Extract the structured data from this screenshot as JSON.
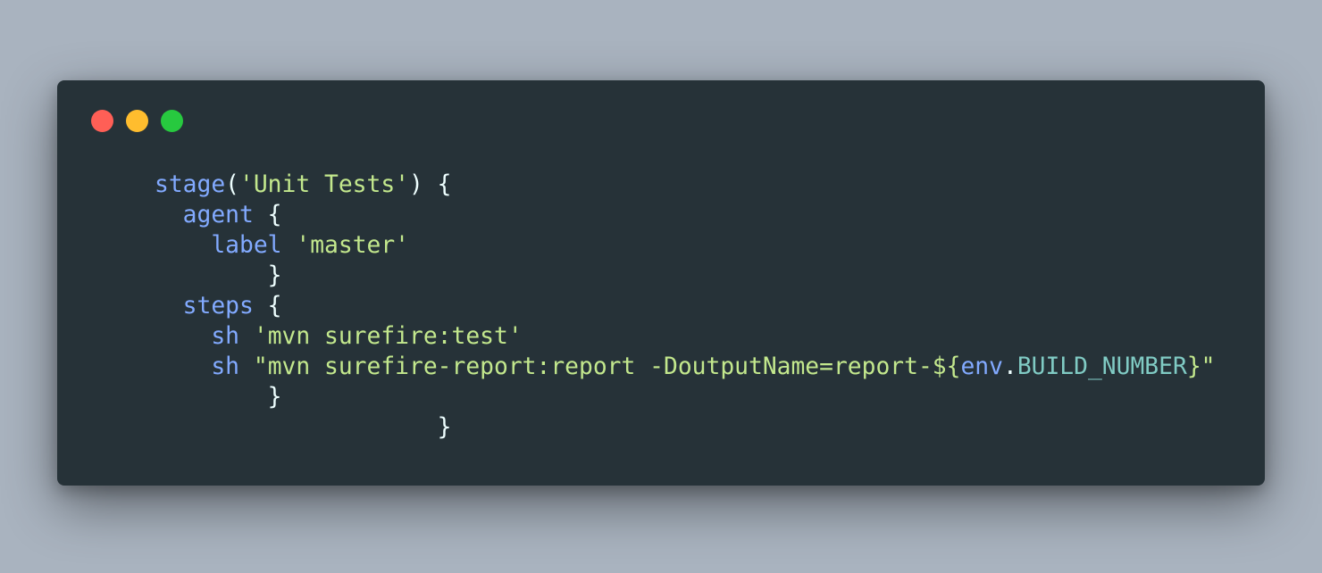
{
  "window": {
    "background": "#263238",
    "controls": [
      {
        "name": "close",
        "color": "#ff5f56"
      },
      {
        "name": "minimize",
        "color": "#ffbd2e"
      },
      {
        "name": "maximize",
        "color": "#27c93f"
      }
    ]
  },
  "theme": {
    "keyword": "#82aaff",
    "string": "#c3e88d",
    "property": "#80cbc4",
    "punctuation": "#eeffff",
    "page_background": "#a9b3bf"
  },
  "code": {
    "lines": [
      [
        {
          "indent": 0,
          "text": "stage",
          "type": "kw"
        },
        {
          "text": "(",
          "type": "punc"
        },
        {
          "text": "'Unit Tests'",
          "type": "str"
        },
        {
          "text": ") {",
          "type": "punc"
        }
      ],
      [
        {
          "indent": 2,
          "text": "agent",
          "type": "kw"
        },
        {
          "text": " {",
          "type": "punc"
        }
      ],
      [
        {
          "indent": 4,
          "text": "label",
          "type": "kw"
        },
        {
          "text": " ",
          "type": "punc"
        },
        {
          "text": "'master'",
          "type": "str"
        }
      ],
      [
        {
          "indent": 8,
          "text": "}",
          "type": "punc"
        }
      ],
      [
        {
          "indent": 2,
          "text": "steps",
          "type": "kw"
        },
        {
          "text": " {",
          "type": "punc"
        }
      ],
      [
        {
          "indent": 4,
          "text": "sh",
          "type": "kw"
        },
        {
          "text": " ",
          "type": "punc"
        },
        {
          "text": "'mvn surefire:test'",
          "type": "str"
        }
      ],
      [
        {
          "indent": 4,
          "text": "sh",
          "type": "kw"
        },
        {
          "text": " ",
          "type": "punc"
        },
        {
          "text": "\"mvn surefire-report:report -DoutputName=report-${",
          "type": "str"
        },
        {
          "text": "env",
          "type": "kw"
        },
        {
          "text": ".",
          "type": "punc"
        },
        {
          "text": "BUILD_NUMBER",
          "type": "prop"
        },
        {
          "text": "}\"",
          "type": "str"
        }
      ],
      [
        {
          "indent": 8,
          "text": "}",
          "type": "punc"
        }
      ],
      [
        {
          "indent": 20,
          "text": "}",
          "type": "punc"
        }
      ]
    ]
  }
}
